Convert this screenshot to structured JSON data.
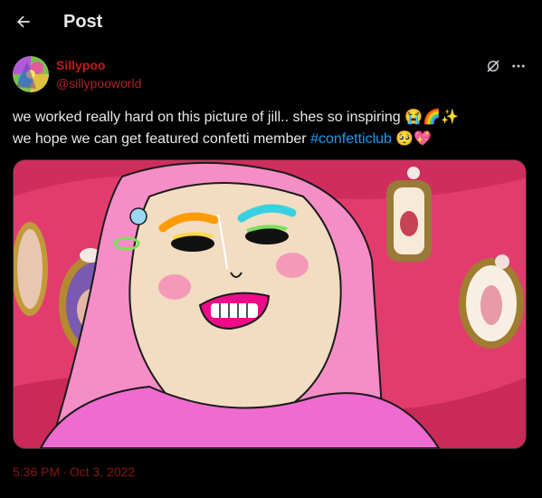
{
  "header": {
    "title": "Post",
    "back_icon": "arrow-left-icon"
  },
  "post": {
    "author_name": "Sillypoo",
    "author_handle": "@sillypooworld",
    "text_line1": "we worked really hard on this picture of jill.. shes so inspiring ",
    "text_line1_emoji": "😭🌈✨",
    "text_line2": "we hope we can get featured confetti member ",
    "hashtag": "#confetticlub",
    "text_line2_emoji": " 🥺💖",
    "time": "5:36 PM",
    "separator": "·",
    "date": "Oct 3, 2022"
  },
  "colors": {
    "background": "#000000",
    "author_name": "#c21a1a",
    "hashtag": "#1d9bf0",
    "timestamp": "#8b1414"
  },
  "icons": [
    "arrow-left-icon",
    "grok-icon",
    "more-icon"
  ]
}
